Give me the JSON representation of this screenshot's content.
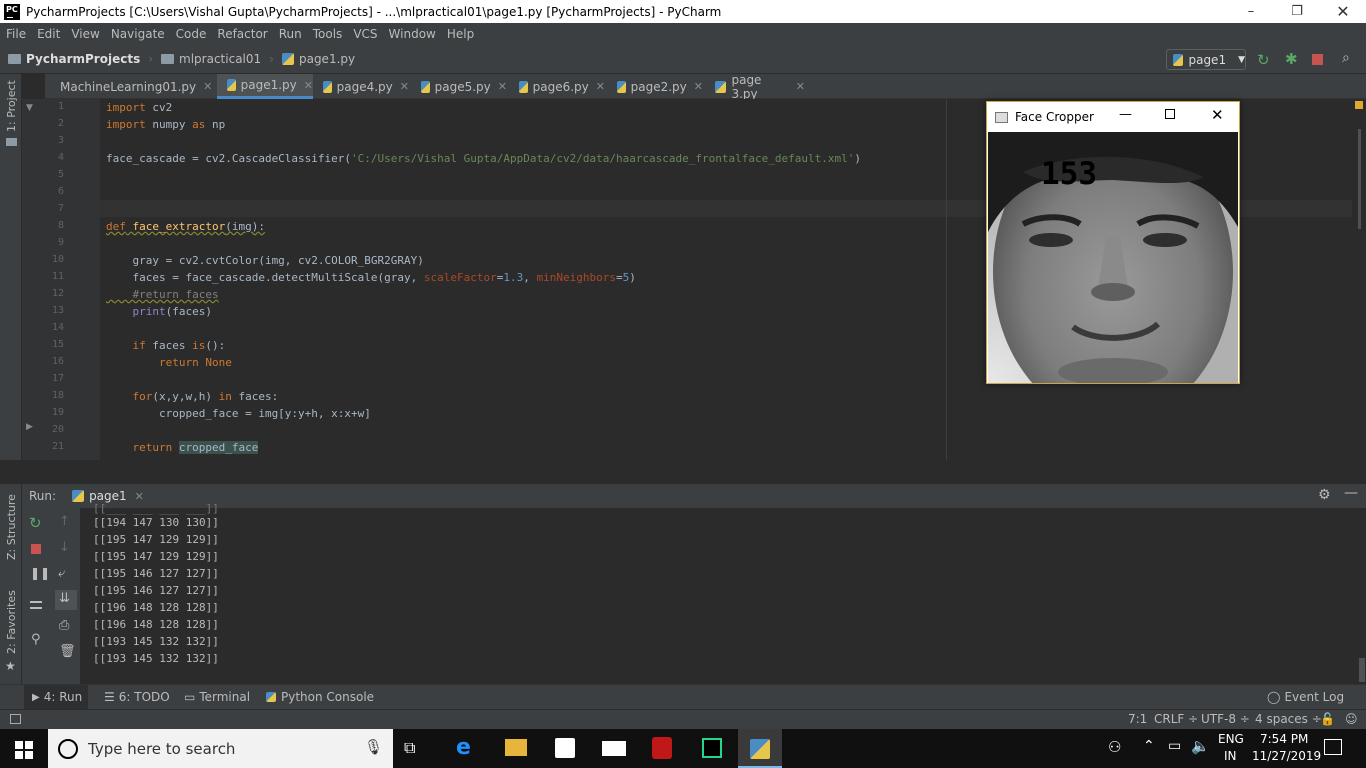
{
  "titlebar": {
    "title": "PycharmProjects [C:\\Users\\Vishal Gupta\\PycharmProjects] - ...\\mlpractical01\\page1.py [PycharmProjects] - PyCharm",
    "logo": "PC"
  },
  "menu": [
    "File",
    "Edit",
    "View",
    "Navigate",
    "Code",
    "Refactor",
    "Run",
    "Tools",
    "VCS",
    "Window",
    "Help"
  ],
  "breadcrumb": {
    "project": "PycharmProjects",
    "folder": "mlpractical01",
    "file": "page1.py"
  },
  "run_config": "page1",
  "left_stripe": {
    "project": "1: Project",
    "structure": "Z: Structure",
    "favorites": "2: Favorites"
  },
  "tabs": [
    {
      "label": "MachineLearning01.py"
    },
    {
      "label": "page1.py"
    },
    {
      "label": "page4.py"
    },
    {
      "label": "page5.py"
    },
    {
      "label": "page6.py"
    },
    {
      "label": "page2.py"
    },
    {
      "label": "page 3.py"
    }
  ],
  "line_numbers": [
    "1",
    "2",
    "3",
    "4",
    "5",
    "6",
    "7",
    "8",
    "9",
    "10",
    "11",
    "12",
    "13",
    "14",
    "15",
    "16",
    "17",
    "18",
    "19",
    "20",
    "21"
  ],
  "code": {
    "l1a": "import",
    "l1b": " cv2",
    "l2a": "import",
    "l2b": " numpy ",
    "l2c": "as",
    "l2d": " np",
    "l4a": "face_cascade = cv2.CascadeClassifier(",
    "l4b": "'C:/Users/Vishal Gupta/AppData/cv2/data/haarcascade_frontalface_default.xml'",
    "l4c": ")",
    "l8a": "def",
    "l8b": " face_extractor",
    "l8c": "(img):",
    "l10": "    gray = cv2.cvtColor(img, cv2.COLOR_BGR2GRAY)",
    "l11a": "    faces = face_cascade.detectMultiScale(gray, ",
    "l11b": "scaleFactor",
    "l11c": "=",
    "l11d": "1.3",
    ", ": ", ",
    "l11e": "minNeighbors",
    "l11f": "=",
    "l11g": "5",
    "l11h": ")",
    "l12": "    #return faces",
    "l13a": "    ",
    "l13b": "print",
    "l13c": "(faces)",
    "l15a": "    ",
    "l15b": "if",
    "l15c": " faces ",
    "l15d": "is",
    "l15e": "():",
    "l16a": "        ",
    "l16b": "return",
    "l16c": " ",
    "l16d": "None",
    "l18a": "    ",
    "l18b": "for",
    "l18c": "(x,y,w,h) ",
    "l18d": "in",
    "l18e": " faces:",
    "l19": "        cropped_face = img[y:y+h, x:x+w]",
    "l21a": "    ",
    "l21b": "return",
    "l21c": " ",
    "l21d": "cropped_face"
  },
  "run": {
    "label": "Run:",
    "tab": "page1"
  },
  "console": [
    "[[194 147 130 130]]",
    "[[195 147 129 129]]",
    "[[195 147 129 129]]",
    "[[195 146 127 127]]",
    "[[195 146 127 127]]",
    "[[196 148 128 128]]",
    "[[196 148 128 128]]",
    "[[193 145 132 132]]",
    "[[193 145 132 132]]"
  ],
  "bottom_tools": {
    "run": "4: Run",
    "todo": "6: TODO",
    "terminal": "Terminal",
    "python_console": "Python Console",
    "event_log": "Event Log"
  },
  "status": {
    "position": "7:1",
    "line_sep": "CRLF ÷",
    "encoding": "UTF-8 ÷",
    "indent": "4 spaces ÷"
  },
  "face_window": {
    "title": "Face Cropper",
    "count": "153"
  },
  "taskbar": {
    "search_placeholder": "Type here to search",
    "lang1": "ENG",
    "lang2": "IN",
    "time": "7:54 PM",
    "date": "11/27/2019"
  },
  "colors": {
    "accent": "#4a88c7",
    "keyword": "#cc7832",
    "string": "#6a8759",
    "number": "#6897bb"
  }
}
